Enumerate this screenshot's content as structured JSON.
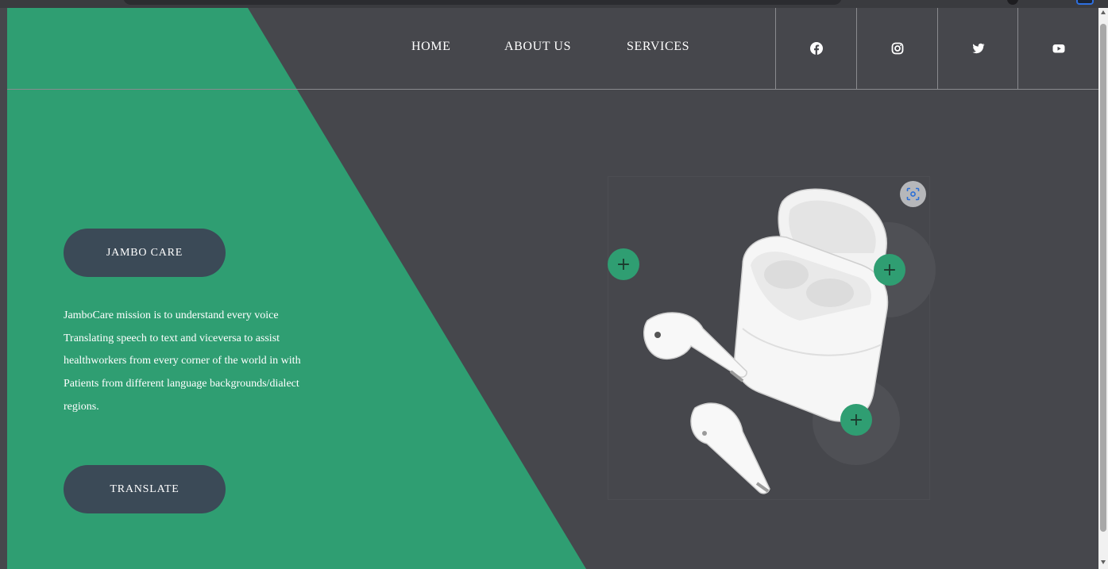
{
  "colors": {
    "accent_green": "#2f9e72",
    "background_dark": "#46474c",
    "button_slate": "#3b4a57",
    "text_white": "#ffffff"
  },
  "nav": {
    "items": [
      {
        "label": "HOME"
      },
      {
        "label": "ABOUT US"
      },
      {
        "label": "SERVICES"
      }
    ]
  },
  "social": {
    "icons": [
      "facebook-icon",
      "instagram-icon",
      "twitter-icon",
      "youtube-icon"
    ]
  },
  "hero": {
    "brand_button_label": "JAMBO CARE",
    "mission_lines": [
      "JamboCare mission is to understand every voice",
      "Translating speech to text and viceversa to assist",
      "healthworkers from every corner of the world in with",
      "Patients from different language backgrounds/dialect",
      "regions."
    ],
    "translate_button_label": "TRANSLATE"
  },
  "product": {
    "hotspot_symbol": "+",
    "lens_icon": "lens-scan-icon"
  }
}
